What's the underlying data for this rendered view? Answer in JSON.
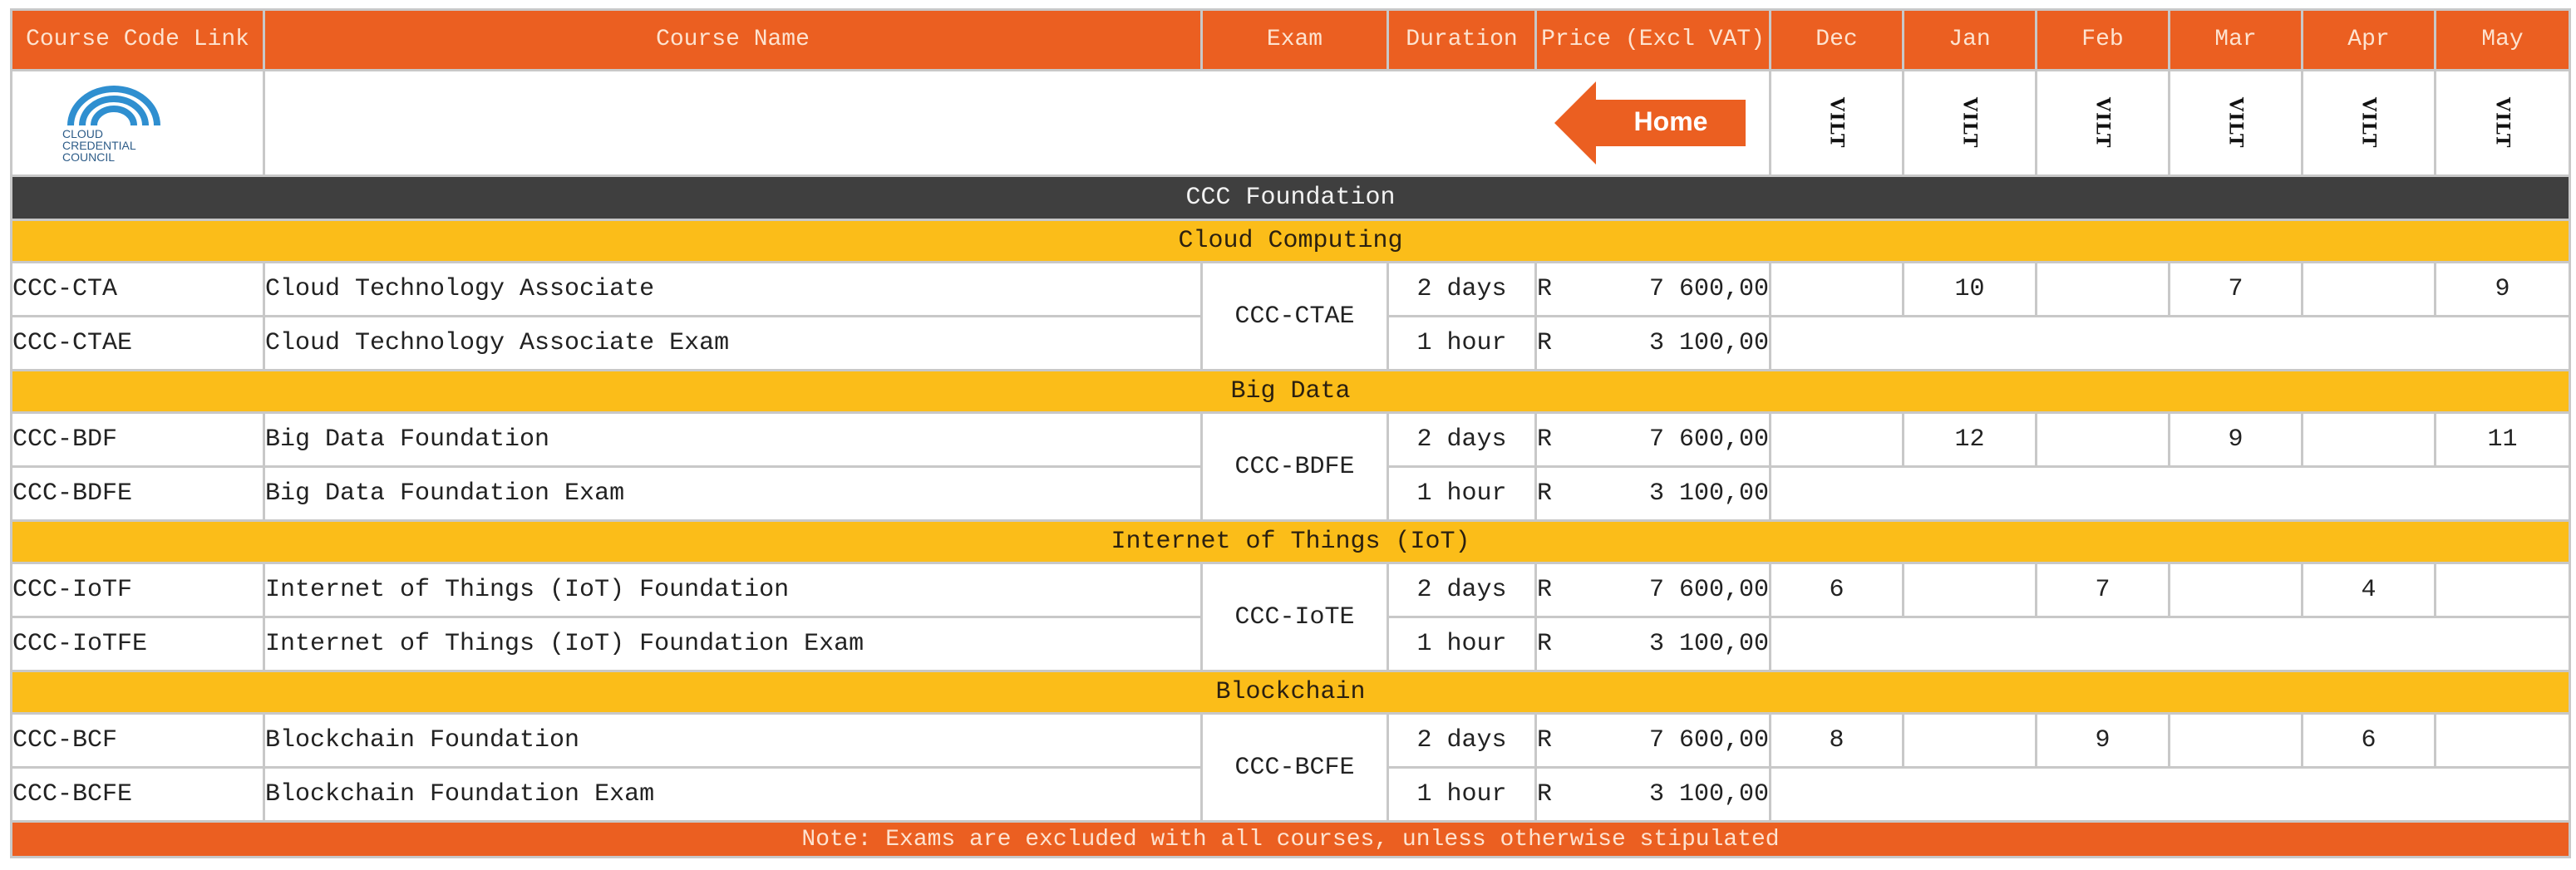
{
  "columns": {
    "code": "Course Code Link",
    "name": "Course Name",
    "exam": "Exam",
    "duration": "Duration",
    "price": "Price (Excl VAT)",
    "months": [
      "Dec",
      "Jan",
      "Feb",
      "Mar",
      "Apr",
      "May"
    ]
  },
  "logo": {
    "icon": "cloud-arc-logo",
    "line1": "CLOUD",
    "line2": "CREDENTIAL",
    "line3": "COUNCIL",
    "color": "#2f8fd0"
  },
  "home_button": {
    "label": "Home",
    "color": "#eb5f21"
  },
  "vertical_label": "VILT",
  "section_title": "CCC Foundation",
  "colors": {
    "header": "#eb5f21",
    "section": "#3f3f3f",
    "category": "#fbbd19"
  },
  "groups": [
    {
      "category": "Cloud Computing",
      "exam": "CCC-CTAE",
      "course": {
        "code": "CCC-CTA",
        "name": "Cloud Technology Associate",
        "duration": "2 days",
        "currency": "R",
        "price": "7 600,00",
        "dates": [
          "",
          "10",
          "",
          "7",
          "",
          "9"
        ]
      },
      "exam_row": {
        "code": "CCC-CTAE",
        "name": "Cloud Technology Associate Exam",
        "duration": "1 hour",
        "currency": "R",
        "price": "3 100,00"
      }
    },
    {
      "category": "Big Data",
      "exam": "CCC-BDFE",
      "course": {
        "code": "CCC-BDF",
        "name": "Big Data Foundation",
        "duration": "2 days",
        "currency": "R",
        "price": "7 600,00",
        "dates": [
          "",
          "12",
          "",
          "9",
          "",
          "11"
        ]
      },
      "exam_row": {
        "code": "CCC-BDFE",
        "name": "Big Data Foundation Exam",
        "duration": "1 hour",
        "currency": "R",
        "price": "3 100,00"
      }
    },
    {
      "category": "Internet of Things (IoT)",
      "exam": "CCC-IoTE",
      "course": {
        "code": "CCC-IoTF",
        "name": "Internet of Things (IoT) Foundation",
        "duration": "2 days",
        "currency": "R",
        "price": "7 600,00",
        "dates": [
          "6",
          "",
          "7",
          "",
          "4",
          ""
        ]
      },
      "exam_row": {
        "code": "CCC-IoTFE",
        "name": "Internet of Things (IoT) Foundation Exam",
        "duration": "1 hour",
        "currency": "R",
        "price": "3 100,00"
      }
    },
    {
      "category": "Blockchain",
      "exam": "CCC-BCFE",
      "course": {
        "code": "CCC-BCF",
        "name": "Blockchain Foundation",
        "duration": "2 days",
        "currency": "R",
        "price": "7 600,00",
        "dates": [
          "8",
          "",
          "9",
          "",
          "6",
          ""
        ]
      },
      "exam_row": {
        "code": "CCC-BCFE",
        "name": "Blockchain Foundation Exam",
        "duration": "1 hour",
        "currency": "R",
        "price": "3 100,00"
      }
    }
  ],
  "note": "Note: Exams are excluded with all courses, unless otherwise stipulated"
}
